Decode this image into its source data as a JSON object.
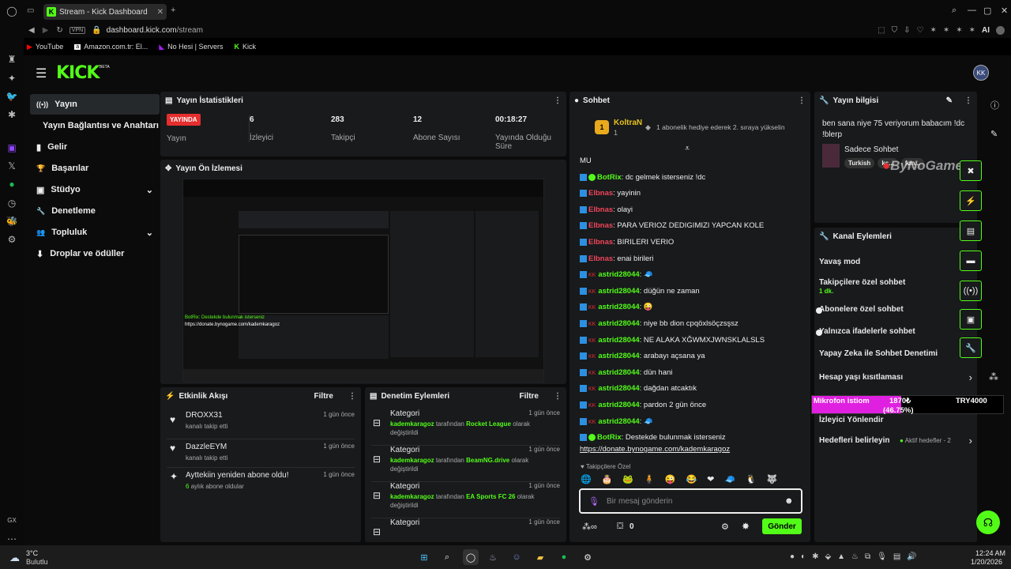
{
  "browser": {
    "tab_title": "Stream - Kick Dashboard",
    "url_host": "dashboard.kick.com",
    "url_path": "/stream",
    "vpn": "VPN",
    "bookmarks": [
      "YouTube",
      "Amazon.com.tr: El...",
      "No Hesi | Servers",
      "Kick"
    ],
    "ai_label": "AI",
    "gx": "GX"
  },
  "app": {
    "logo": "KICK",
    "beta": "BETA",
    "avatar": "KK"
  },
  "nav": [
    {
      "label": "Yayın",
      "icon": "((•))"
    },
    {
      "label": "Yayın Bağlantısı ve Anahtarı",
      "icon": ""
    },
    {
      "label": "Gelir",
      "icon": "▮"
    },
    {
      "label": "Başarılar",
      "icon": "🏆"
    },
    {
      "label": "Stüdyo",
      "icon": "▣"
    },
    {
      "label": "Denetleme",
      "icon": "🔧"
    },
    {
      "label": "Topluluk",
      "icon": "👥"
    },
    {
      "label": "Droplar ve ödüller",
      "icon": "⬇"
    }
  ],
  "stats": {
    "title": "Yayın İstatistikleri",
    "live_badge": "YAYINDA",
    "live_label": "Yayın",
    "viewers": "6",
    "viewers_label": "İzleyici",
    "followers": "283",
    "followers_label": "Takipçi",
    "subs": "12",
    "subs_label": "Abone Sayısı",
    "uptime": "00:18:27",
    "uptime_label": "Yayında Olduğu Süre"
  },
  "preview": {
    "title": "Yayın Ön İzlemesi",
    "botrix_line": "BotRix: Destekde bulunmak isterseniz",
    "donate": "https://donate.bynogame.com/kademkaragoz"
  },
  "activity": {
    "title": "Etkinlik Akışı",
    "filter": "Filtre",
    "items": [
      {
        "name": "DROXX31",
        "desc": "kanalı takip etti",
        "time": "1 gün önce"
      },
      {
        "name": "DazzleEYM",
        "desc": "kanalı takip etti",
        "time": "1 gün önce"
      },
      {
        "name": "Ayttekiin yeniden abone oldu!",
        "desc_num": "6",
        "desc": "aylık abone oldular",
        "time": "1 gün önce"
      }
    ]
  },
  "moderation": {
    "title": "Denetim Eylemleri",
    "filter": "Filtre",
    "items": [
      {
        "title": "Kategori",
        "user": "kademkaragoz",
        "mid": "tarafından",
        "cat": "Rocket League",
        "end": "olarak değiştirildi",
        "time": "1 gün önce"
      },
      {
        "title": "Kategori",
        "user": "kademkaragoz",
        "mid": "tarafından",
        "cat": "BeamNG.drive",
        "end": "olarak değiştirildi",
        "time": "1 gün önce"
      },
      {
        "title": "Kategori",
        "user": "kademkaragoz",
        "mid": "tarafından",
        "cat": "EA Sports FC 26",
        "end": "olarak değiştirildi",
        "time": "1 gün önce"
      },
      {
        "title": "Kategori",
        "user": "",
        "mid": "",
        "cat": "",
        "end": "",
        "time": "1 gün önce"
      }
    ]
  },
  "chat": {
    "title": "Sohbet",
    "pinned_user": "KoltraN",
    "pinned_count": "1",
    "pinned_msg": "1 abonelik hediye ederek 2. sıraya yükselin",
    "messages": [
      {
        "user": "",
        "text": "MU",
        "color": "plain"
      },
      {
        "user": "BotRix",
        "text": ": dc gelmek isterseniz !dc",
        "color": "green"
      },
      {
        "user": "Elbnas",
        "text": ": yayinin",
        "color": "red"
      },
      {
        "user": "Elbnas",
        "text": ": olayi",
        "color": "red"
      },
      {
        "user": "Elbnas",
        "text": ": PARA VERIOZ DEDIGIMIZI YAPCAN KOLE",
        "color": "red"
      },
      {
        "user": "Elbnas",
        "text": ": BIRILERI VERIO",
        "color": "red"
      },
      {
        "user": "Elbnas",
        "text": ": enai birileri",
        "color": "red"
      },
      {
        "user": "astrid28044",
        "text": ": 🧢",
        "color": "green"
      },
      {
        "user": "astrid28044",
        "text": ": düğün ne zaman",
        "color": "green"
      },
      {
        "user": "astrid28044",
        "text": ": 😜",
        "color": "green"
      },
      {
        "user": "astrid28044",
        "text": ": niye bb dion cpqöxlsöçzsşsz",
        "color": "green"
      },
      {
        "user": "astrid28044",
        "text": ": NE ALAKA XĞWMXJWNSKLALSLS",
        "color": "green"
      },
      {
        "user": "astrid28044",
        "text": ": arabayı açsana ya",
        "color": "green"
      },
      {
        "user": "astrid28044",
        "text": ": dün hani",
        "color": "green"
      },
      {
        "user": "astrid28044",
        "text": ": dağdan atcaktık",
        "color": "green"
      },
      {
        "user": "astrid28044",
        "text": ": pardon 2 gün önce",
        "color": "green"
      },
      {
        "user": "astrid28044",
        "text": ": 🧢",
        "color": "green"
      },
      {
        "user": "BotRix",
        "text": ": Destekde bulunmak isterseniz",
        "color": "green"
      }
    ],
    "donate": "https://donate.bynogame.com/kademkaragoz",
    "emote_label": "Takipçilere Özel",
    "placeholder": "Bir mesaj gönderin",
    "points": "0",
    "send": "Gönder"
  },
  "info": {
    "title": "Yayın bilgisi",
    "stream_title": "ben sana niye 75 veriyorum babacım !dc !blerp",
    "category": "Sadece Sohbet",
    "tags": [
      "Turkish",
      "kç...",
      "fun..."
    ],
    "watermark": "ByNoGame"
  },
  "channel": {
    "title": "Kanal Eylemleri",
    "items": [
      {
        "label": "Yavaş mod",
        "type": "chevron"
      },
      {
        "label": "Takipçilere özel sohbet",
        "sub": "1 dk.",
        "type": "chevron"
      },
      {
        "label": "Abonelere özel sohbet",
        "type": "toggle"
      },
      {
        "label": "Yalnızca ifadelerle sohbet",
        "type": "toggle"
      },
      {
        "label": "Yapay Zeka ile Sohbet Denetimi",
        "type": "link"
      },
      {
        "label": "Hesap yaşı kısıtlaması",
        "type": "chevron"
      },
      {
        "label": "İzleyici Yönlendir",
        "type": "none"
      },
      {
        "label": "Hedefleri belirleyin",
        "sub": "Aktif hedefler - 2",
        "type": "chevron"
      }
    ],
    "mic_label": "Mikrofon istiom",
    "mic_amount": "1870₺",
    "mic_pct": "(46.75%)",
    "mic_goal": "TRY4000",
    "mic_fraction": 0.4675
  },
  "taskbar": {
    "temp": "3°C",
    "weather": "Bulutlu",
    "time": "12:24 AM",
    "date": "1/20/2026"
  }
}
